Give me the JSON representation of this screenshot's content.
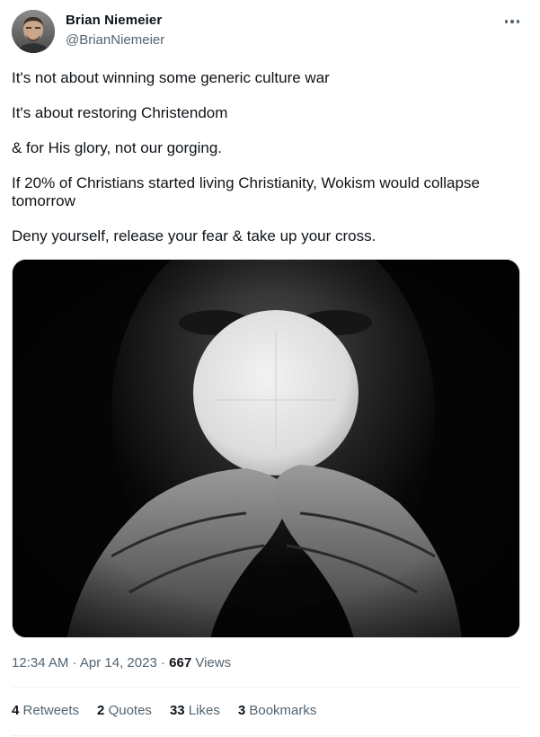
{
  "author": {
    "name": "Brian Niemeier",
    "handle": "@BrianNiemeier"
  },
  "tweet": {
    "paragraphs": [
      "It's not about winning some generic culture war",
      "It's about restoring Christendom",
      "& for His glory, not our gorging.",
      "If 20% of Christians started living Christianity, Wokism would collapse tomorrow",
      "Deny yourself, release your fear & take up your cross."
    ]
  },
  "meta": {
    "time": "12:34 AM",
    "separator": "·",
    "date": "Apr 14, 2023",
    "views_count": "667",
    "views_label": "Views"
  },
  "stats": {
    "retweets": {
      "count": "4",
      "label": "Retweets"
    },
    "quotes": {
      "count": "2",
      "label": "Quotes"
    },
    "likes": {
      "count": "33",
      "label": "Likes"
    },
    "bookmarks": {
      "count": "3",
      "label": "Bookmarks"
    }
  },
  "colors": {
    "text_primary": "#0f1419",
    "text_secondary": "#536471",
    "divider": "#eff3f4"
  }
}
